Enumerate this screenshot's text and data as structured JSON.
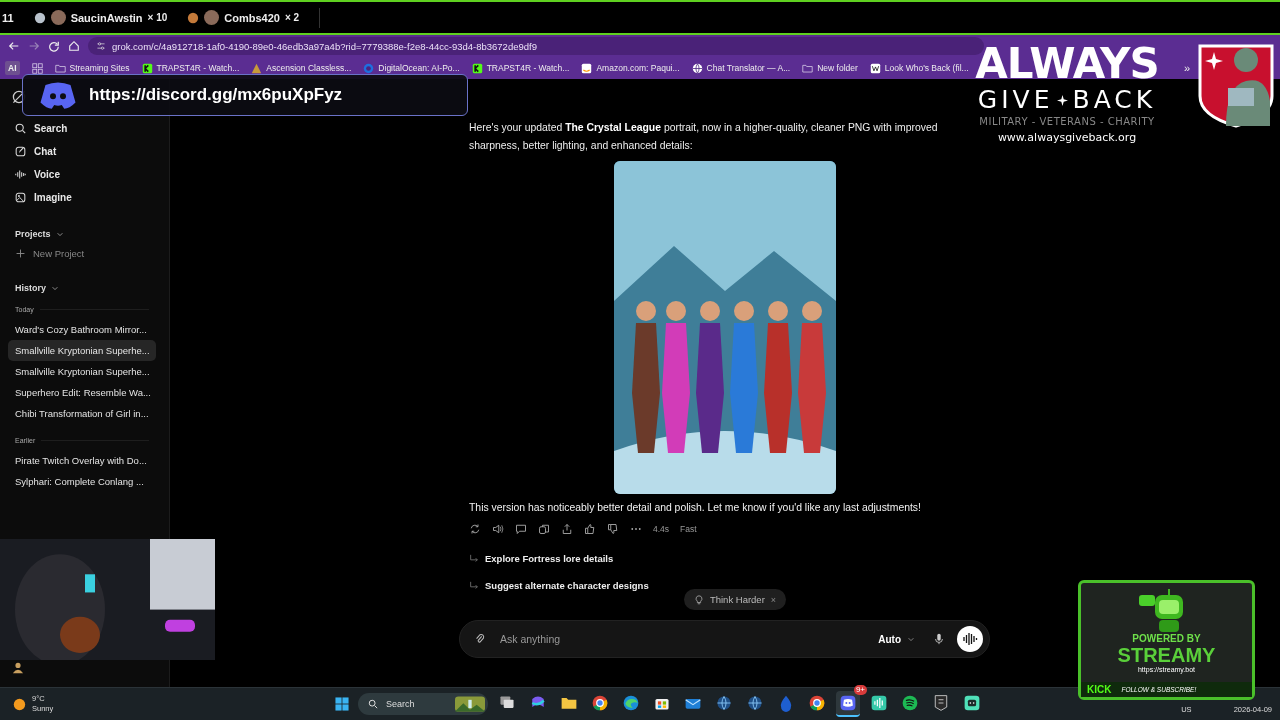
{
  "stream_bar": {
    "rank_label": "11",
    "gifters": [
      {
        "name": "SaucinAwstin",
        "count": "× 10",
        "color": "#b9c2cc"
      },
      {
        "name": "Combs420",
        "count": "× 2",
        "color": "#c47a3a"
      }
    ]
  },
  "browser": {
    "url": "grok.com/c/4a912718-1af0-4190-89e0-46edb3a97a4b?rid=7779388e-f2e8-44cc-93d4-8b3672de9df9",
    "bookmarks": [
      {
        "kind": "badge",
        "label": "AI"
      },
      {
        "kind": "apps"
      },
      {
        "kind": "folder",
        "label": "Streaming Sites"
      },
      {
        "kind": "kick",
        "label": "TRAPST4R - Watch..."
      },
      {
        "kind": "ascension",
        "label": "Ascension Classless..."
      },
      {
        "kind": "ocean",
        "label": "DigitalOcean: AI-Po..."
      },
      {
        "kind": "kick",
        "label": "TRAPST4R - Watch..."
      },
      {
        "kind": "amazon",
        "label": "Amazon.com: Paqui..."
      },
      {
        "kind": "globe",
        "label": "Chat Translator — A..."
      },
      {
        "kind": "folder",
        "label": "New folder"
      },
      {
        "kind": "wiki",
        "label": "Look Who's Back (fil..."
      }
    ],
    "more": "»"
  },
  "sidebar": {
    "nav": [
      {
        "kind": "search",
        "label": "Search"
      },
      {
        "kind": "chat",
        "label": "Chat"
      },
      {
        "kind": "voice",
        "label": "Voice"
      },
      {
        "kind": "imagine",
        "label": "Imagine"
      }
    ],
    "projects": {
      "title": "Projects",
      "new_project": "New Project"
    },
    "history": {
      "title": "History",
      "groups": [
        {
          "label": "Today",
          "items": [
            {
              "title": "Ward's Cozy Bathroom Mirror...",
              "selected": false
            },
            {
              "title": "Smallville Kryptonian Superhe...",
              "selected": true
            },
            {
              "title": "Smallville Kryptonian Superhe...",
              "selected": false
            },
            {
              "title": "Superhero Edit: Resemble Wa...",
              "selected": false
            },
            {
              "title": "Chibi Transformation of Girl in...",
              "selected": false
            }
          ]
        },
        {
          "label": "Earlier",
          "items": [
            {
              "title": "Pirate Twitch Overlay with Do...",
              "selected": false
            },
            {
              "title": "Sylphari: Complete Conlang ...",
              "selected": false
            }
          ]
        }
      ]
    }
  },
  "chat": {
    "intro": "Here's your updated **The Crystal League** portrait, now in a higher-quality, cleaner PNG with improved sharpness, better lighting, and enhanced details:",
    "reply": "This version has noticeably better detail and polish. Let me know if you'd like any last adjustments!",
    "meta": {
      "time": "4.4s",
      "mode": "Fast"
    },
    "suggestions": [
      "Explore Fortress lore details",
      "Suggest alternate character designs"
    ],
    "chip": {
      "label": "Think Harder",
      "close": "×"
    },
    "composer": {
      "placeholder": "Ask anything",
      "model": "Auto"
    }
  },
  "taskbar": {
    "weather": {
      "temp": "9°C",
      "condition": "Sunny"
    },
    "search": {
      "placeholder": "Search"
    },
    "apps": [
      {
        "kind": "taskview",
        "active": false
      },
      {
        "kind": "m365",
        "active": false
      },
      {
        "kind": "folder",
        "active": false
      },
      {
        "kind": "chrome",
        "active": false
      },
      {
        "kind": "edge",
        "active": false
      },
      {
        "kind": "store",
        "active": false
      },
      {
        "kind": "mail",
        "active": false
      },
      {
        "kind": "globe",
        "active": false
      },
      {
        "kind": "globe",
        "active": false
      },
      {
        "kind": "drop",
        "active": false
      },
      {
        "kind": "chrome",
        "active": false
      },
      {
        "kind": "discord",
        "active": true,
        "badge": "9+"
      },
      {
        "kind": "wave",
        "active": false
      },
      {
        "kind": "spotify",
        "active": false
      },
      {
        "kind": "epic",
        "active": false
      },
      {
        "kind": "bot",
        "active": false
      }
    ],
    "tray": {
      "lang": "US",
      "date": "2026-04-09"
    }
  },
  "overlays": {
    "discord": {
      "link": "https://discord.gg/mx6puXpFyz"
    },
    "charity": {
      "line1": "ALWAYS",
      "line2a": "GIVE",
      "line2b": "BACK",
      "tagline": "MILITARY - VETERANS - CHARITY",
      "url": "www.alwaysgiveback.org"
    },
    "streamy": {
      "top": "POWERED BY",
      "name": "STREAMY",
      "url": "https://streamy.bot",
      "platform": "KICK",
      "cta": "FOLLOW & SUBSCRIBE!"
    }
  }
}
